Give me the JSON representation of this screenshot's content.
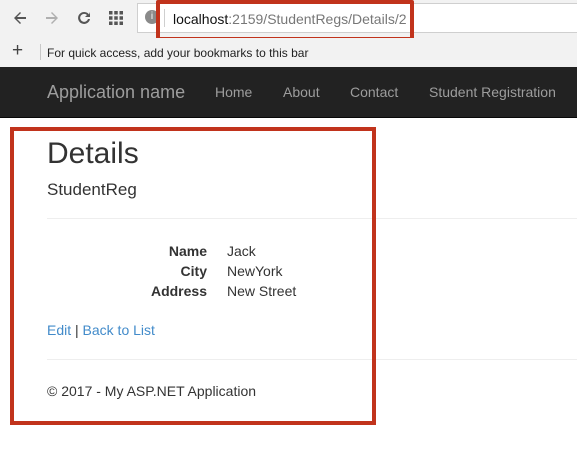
{
  "browser": {
    "url_host": "localhost",
    "url_path": ":2159/StudentRegs/Details/2",
    "bookmarks_hint": "For quick access, add your bookmarks to this bar",
    "add_bookmark": "+",
    "site_info": "i"
  },
  "navbar": {
    "brand": "Application name",
    "links": [
      "Home",
      "About",
      "Contact",
      "Student Registration"
    ]
  },
  "page": {
    "title": "Details",
    "subtitle": "StudentReg",
    "fields": [
      {
        "label": "Name",
        "value": "Jack"
      },
      {
        "label": "City",
        "value": "NewYork"
      },
      {
        "label": "Address",
        "value": "New Street"
      }
    ],
    "edit_link": "Edit",
    "separator": "|",
    "back_link": "Back to List",
    "footer": "© 2017 - My ASP.NET Application"
  },
  "colors": {
    "highlight_border": "#c1331c",
    "navbar_bg": "#222222",
    "link": "#428bca"
  }
}
